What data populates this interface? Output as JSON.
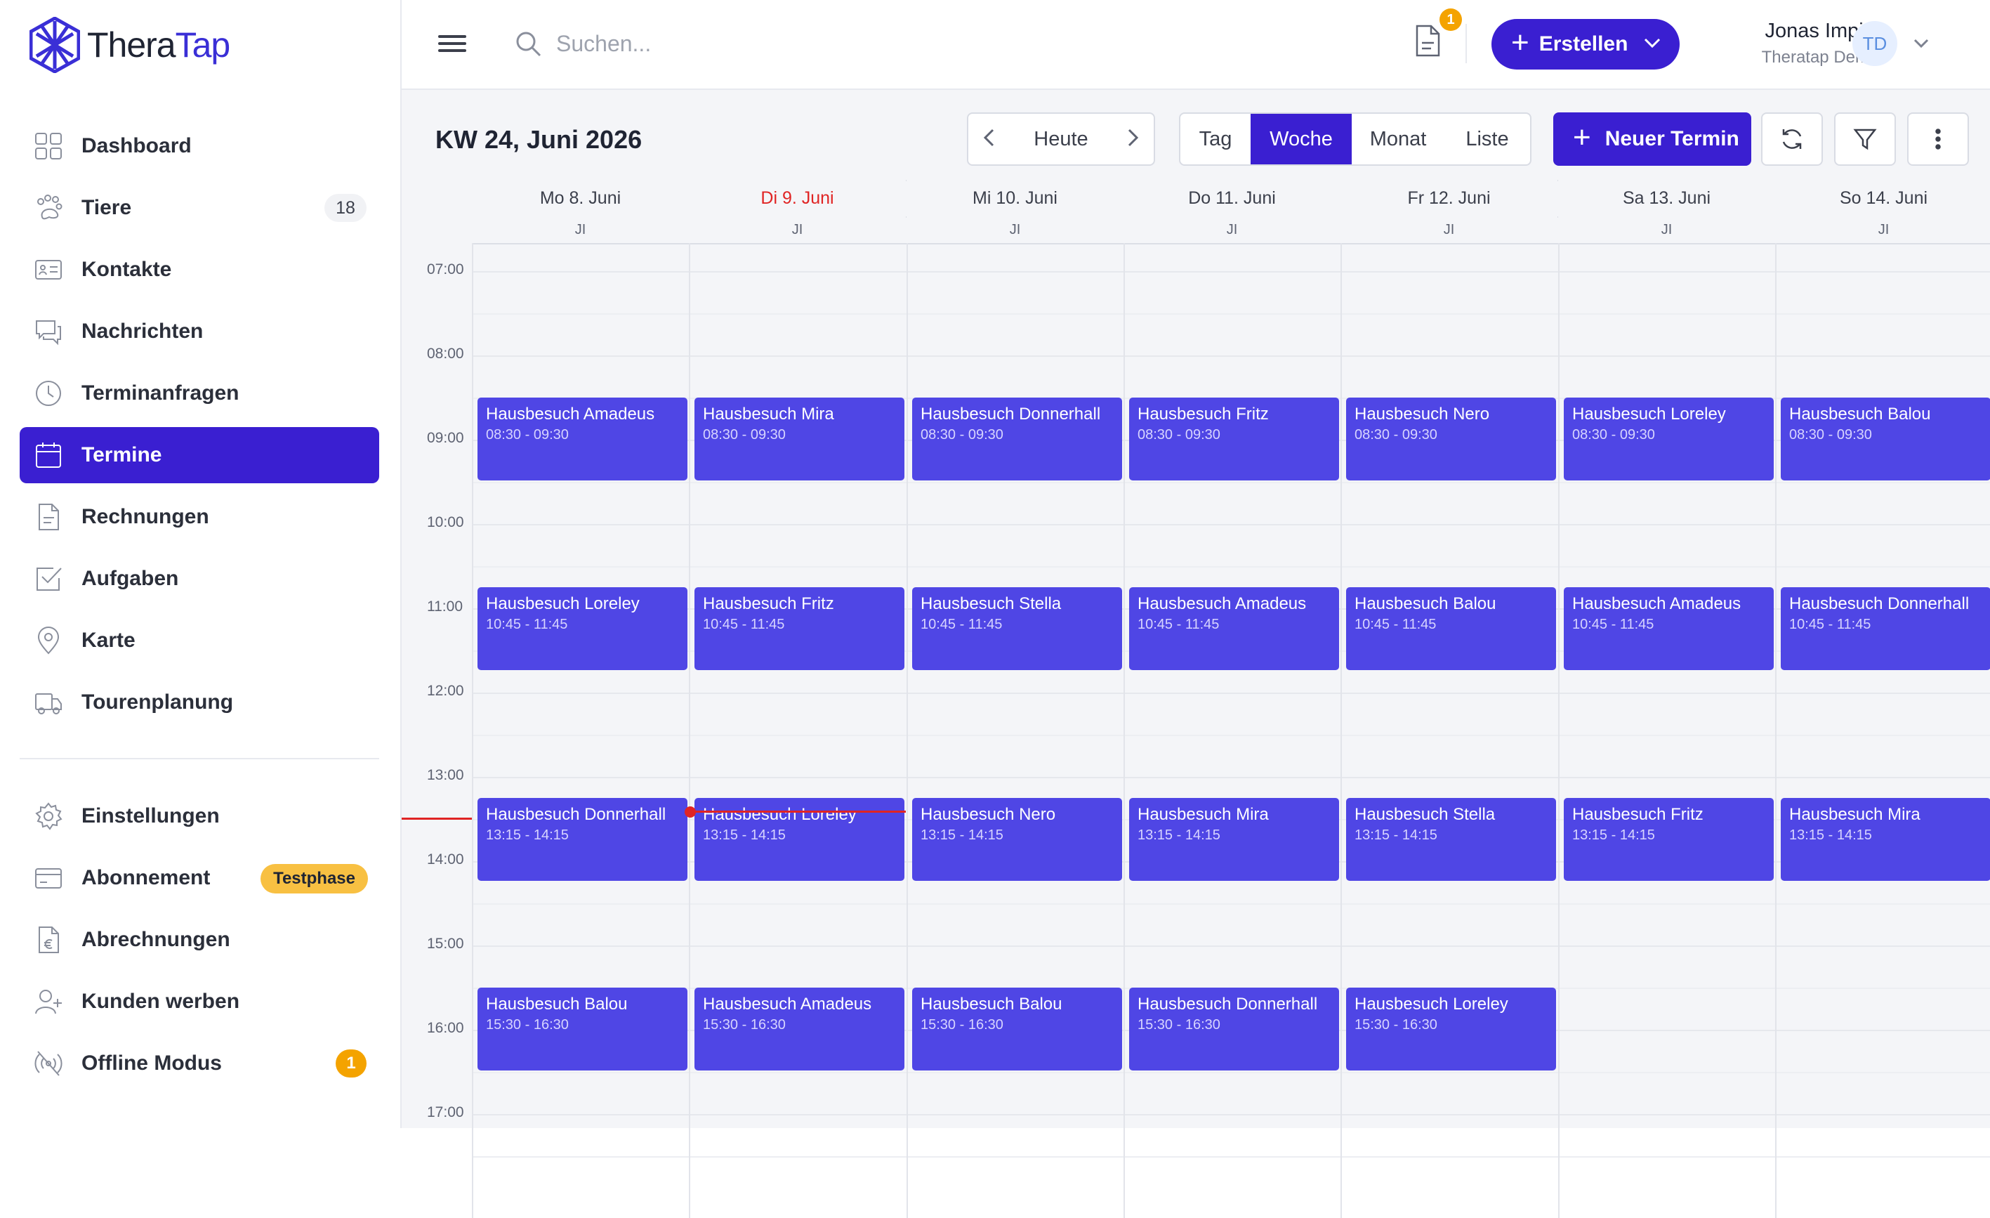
{
  "app": {
    "logo_part1": "Thera",
    "logo_part2": "Tap"
  },
  "sidebar": {
    "items": [
      {
        "label": "Dashboard",
        "icon": "grid-icon"
      },
      {
        "label": "Tiere",
        "icon": "paw-icon",
        "badge": "18"
      },
      {
        "label": "Kontakte",
        "icon": "contact-card-icon"
      },
      {
        "label": "Nachrichten",
        "icon": "chat-icon"
      },
      {
        "label": "Terminanfragen",
        "icon": "clock-icon"
      },
      {
        "label": "Termine",
        "icon": "calendar-icon",
        "active": true
      },
      {
        "label": "Rechnungen",
        "icon": "document-icon"
      },
      {
        "label": "Aufgaben",
        "icon": "checkbox-icon"
      },
      {
        "label": "Karte",
        "icon": "map-pin-icon"
      },
      {
        "label": "Tourenplanung",
        "icon": "truck-icon"
      }
    ],
    "bottom_items": [
      {
        "label": "Einstellungen",
        "icon": "gear-icon"
      },
      {
        "label": "Abonnement",
        "icon": "credit-card-icon",
        "badge": "Testphase"
      },
      {
        "label": "Abrechnungen",
        "icon": "euro-document-icon"
      },
      {
        "label": "Kunden werben",
        "icon": "add-user-icon"
      },
      {
        "label": "Offline Modus",
        "icon": "signal-icon",
        "badge": "1"
      }
    ]
  },
  "topbar": {
    "search_placeholder": "Suchen...",
    "doc_badge": "1",
    "create_label": "Erstellen",
    "user_name": "Jonas Imping",
    "user_org": "Theratap Dem…",
    "avatar_initials": "TD"
  },
  "calendar": {
    "title": "KW 24, Juni 2026",
    "today_label": "Heute",
    "views": [
      "Tag",
      "Woche",
      "Monat",
      "Liste"
    ],
    "active_view": "Woche",
    "new_appointment_label": "Neuer Termin",
    "days": [
      {
        "label": "Mo 8. Juni",
        "allday": "JI"
      },
      {
        "label": "Di 9. Juni",
        "allday": "JI",
        "today": true
      },
      {
        "label": "Mi 10. Juni",
        "allday": "JI"
      },
      {
        "label": "Do 11. Juni",
        "allday": "JI"
      },
      {
        "label": "Fr 12. Juni",
        "allday": "JI"
      },
      {
        "label": "Sa 13. Juni",
        "allday": "JI"
      },
      {
        "label": "So 14. Juni",
        "allday": "JI"
      }
    ],
    "hours": [
      "07:00",
      "08:00",
      "09:00",
      "10:00",
      "11:00",
      "12:00",
      "13:00",
      "14:00",
      "15:00",
      "16:00",
      "17:00"
    ],
    "events": [
      {
        "day": 0,
        "title": "Hausbesuch Amadeus",
        "time": "08:30 - 09:30",
        "start": 8.5
      },
      {
        "day": 1,
        "title": "Hausbesuch Mira",
        "time": "08:30 - 09:30",
        "start": 8.5
      },
      {
        "day": 2,
        "title": "Hausbesuch Donnerhall",
        "time": "08:30 - 09:30",
        "start": 8.5
      },
      {
        "day": 3,
        "title": "Hausbesuch Fritz",
        "time": "08:30 - 09:30",
        "start": 8.5
      },
      {
        "day": 4,
        "title": "Hausbesuch Nero",
        "time": "08:30 - 09:30",
        "start": 8.5
      },
      {
        "day": 5,
        "title": "Hausbesuch Loreley",
        "time": "08:30 - 09:30",
        "start": 8.5
      },
      {
        "day": 6,
        "title": "Hausbesuch Balou",
        "time": "08:30 - 09:30",
        "start": 8.5
      },
      {
        "day": 0,
        "title": "Hausbesuch Loreley",
        "time": "10:45 - 11:45",
        "start": 10.75
      },
      {
        "day": 1,
        "title": "Hausbesuch Fritz",
        "time": "10:45 - 11:45",
        "start": 10.75
      },
      {
        "day": 2,
        "title": "Hausbesuch Stella",
        "time": "10:45 - 11:45",
        "start": 10.75
      },
      {
        "day": 3,
        "title": "Hausbesuch Amadeus",
        "time": "10:45 - 11:45",
        "start": 10.75
      },
      {
        "day": 4,
        "title": "Hausbesuch Balou",
        "time": "10:45 - 11:45",
        "start": 10.75
      },
      {
        "day": 5,
        "title": "Hausbesuch Amadeus",
        "time": "10:45 - 11:45",
        "start": 10.75
      },
      {
        "day": 6,
        "title": "Hausbesuch Donnerhall",
        "time": "10:45 - 11:45",
        "start": 10.75
      },
      {
        "day": 0,
        "title": "Hausbesuch Donnerhall",
        "time": "13:15 - 14:15",
        "start": 13.25
      },
      {
        "day": 1,
        "title": "Hausbesuch Loreley",
        "time": "13:15 - 14:15",
        "start": 13.25
      },
      {
        "day": 2,
        "title": "Hausbesuch Nero",
        "time": "13:15 - 14:15",
        "start": 13.25
      },
      {
        "day": 3,
        "title": "Hausbesuch Mira",
        "time": "13:15 - 14:15",
        "start": 13.25
      },
      {
        "day": 4,
        "title": "Hausbesuch Stella",
        "time": "13:15 - 14:15",
        "start": 13.25
      },
      {
        "day": 5,
        "title": "Hausbesuch Fritz",
        "time": "13:15 - 14:15",
        "start": 13.25
      },
      {
        "day": 6,
        "title": "Hausbesuch Mira",
        "time": "13:15 - 14:15",
        "start": 13.25
      },
      {
        "day": 0,
        "title": "Hausbesuch Balou",
        "time": "15:30 - 16:30",
        "start": 15.5
      },
      {
        "day": 1,
        "title": "Hausbesuch Amadeus",
        "time": "15:30 - 16:30",
        "start": 15.5
      },
      {
        "day": 2,
        "title": "Hausbesuch Balou",
        "time": "15:30 - 16:30",
        "start": 15.5
      },
      {
        "day": 3,
        "title": "Hausbesuch Donnerhall",
        "time": "15:30 - 16:30",
        "start": 15.5
      },
      {
        "day": 4,
        "title": "Hausbesuch Loreley",
        "time": "15:30 - 16:30",
        "start": 15.5
      }
    ],
    "colors": {
      "accent": "#3a1fd1",
      "event": "#4f46e5",
      "today": "#e02424"
    }
  }
}
